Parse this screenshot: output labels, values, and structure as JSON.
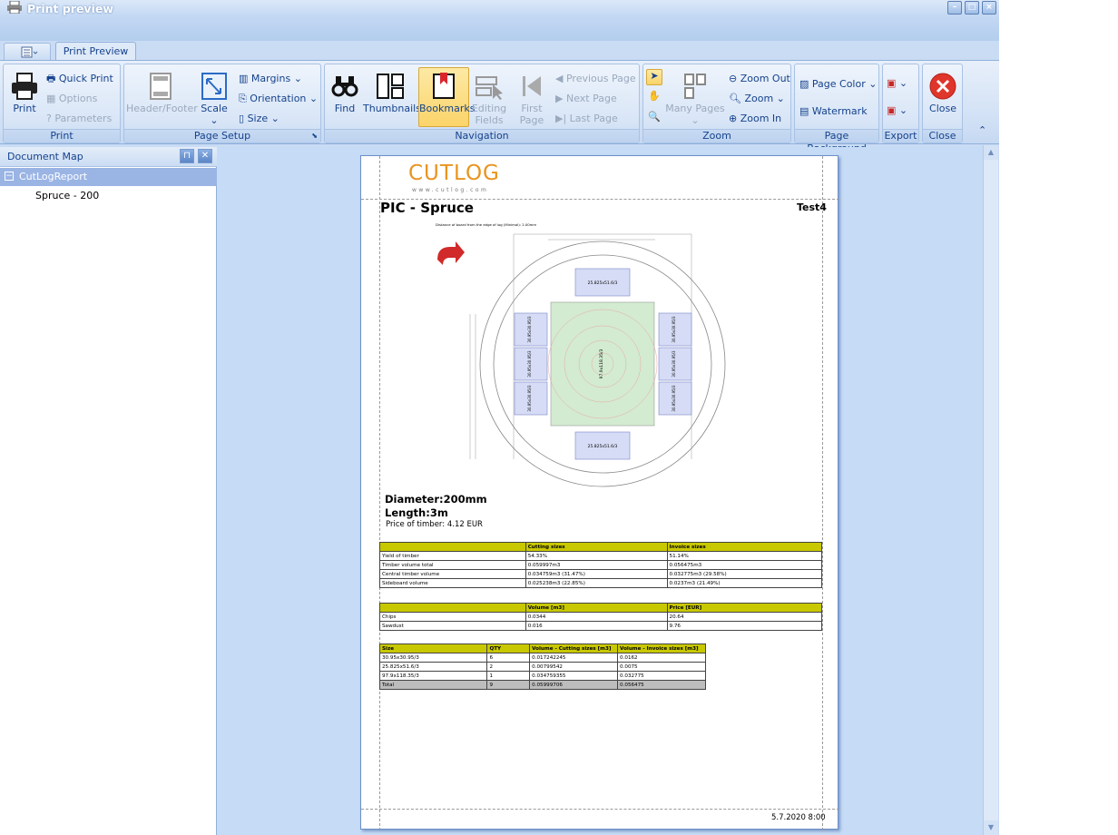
{
  "window": {
    "title": "Print preview"
  },
  "tabs": {
    "active": "Print Preview"
  },
  "ribbon": {
    "print": {
      "caption": "Print",
      "print": "Print",
      "quick_print": "Quick Print",
      "options": "Options",
      "parameters": "Parameters"
    },
    "page_setup": {
      "caption": "Page Setup",
      "header_footer": "Header/Footer",
      "scale": "Scale",
      "margins": "Margins",
      "orientation": "Orientation",
      "size": "Size"
    },
    "navigation": {
      "caption": "Navigation",
      "find": "Find",
      "thumbnails": "Thumbnails",
      "bookmarks": "Bookmarks",
      "editing_fields": "Editing Fields",
      "first_page": "First Page",
      "previous_page": "Previous Page",
      "next_page": "Next Page",
      "last_page": "Last Page"
    },
    "zoom": {
      "caption": "Zoom",
      "many_pages": "Many Pages",
      "zoom_out": "Zoom Out",
      "zoom": "Zoom",
      "zoom_in": "Zoom In"
    },
    "page_background": {
      "caption": "Page Background",
      "page_color": "Page Color",
      "watermark": "Watermark"
    },
    "export": {
      "caption": "Export"
    },
    "close": {
      "caption": "Close",
      "close": "Close"
    }
  },
  "document_map": {
    "title": "Document Map",
    "root": "CutLogReport",
    "child": "Spruce - 200"
  },
  "report": {
    "logo": "CUTLOG",
    "logo_sub": "www.cutlog.com",
    "title": "PIC - Spruce",
    "test": "Test4",
    "diagram_caption": "Distance of board from the edge of log (Minimal): 2.00mm",
    "diameter": "Diameter:200mm",
    "length": "Length:3m",
    "price": "Price of timber: 4.12 EUR",
    "footer_date": "5.7.2020 8:00",
    "board_side": "25.825x51.6/3",
    "board_small": "30.95x30.95/3",
    "board_center": "97.9x118.35/3",
    "table1": {
      "headers": [
        "",
        "Cutting sizes",
        "Invoice sizes"
      ],
      "rows": [
        [
          "Yield of timber",
          "54.33%",
          "51.14%"
        ],
        [
          "Timber volume total",
          "0.059997m3",
          "0.056475m3"
        ],
        [
          "Central timber volume",
          "0.034759m3 (31.47%)",
          "0.032775m3 (29.58%)"
        ],
        [
          "Sideboard volume",
          "0.025238m3 (22.85%)",
          "0.0237m3 (21.49%)"
        ]
      ]
    },
    "table2": {
      "headers": [
        "",
        "Volume [m3]",
        "Price [EUR]"
      ],
      "rows": [
        [
          "Chips",
          "0.0344",
          "20.64"
        ],
        [
          "Sawdust",
          "0.016",
          "9.76"
        ]
      ]
    },
    "table3": {
      "headers": [
        "Size",
        "QTY",
        "Volume - Cutting sizes [m3]",
        "Volume - Invoice sizes [m3]"
      ],
      "rows": [
        [
          "30.95x30.95/3",
          "6",
          "0.017242245",
          "0.0162"
        ],
        [
          "25.825x51.6/3",
          "2",
          "0.00799542",
          "0.0075"
        ],
        [
          "97.9x118.35/3",
          "1",
          "0.034759355",
          "0.032775"
        ]
      ],
      "total": [
        "Total",
        "9",
        "0.05999706",
        "0.056475"
      ]
    }
  }
}
